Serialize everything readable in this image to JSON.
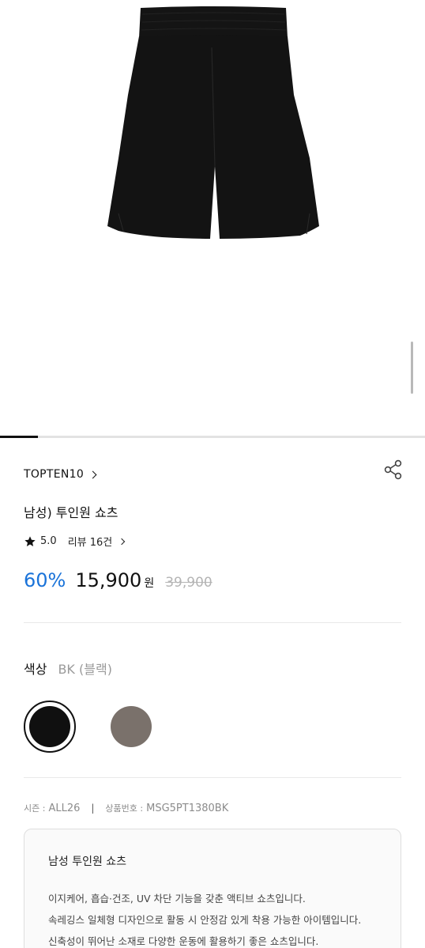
{
  "product": {
    "brand": "TOPTEN10",
    "title": "남성) 투인원 쇼츠",
    "rating": "5.0",
    "reviews_label": "리뷰 16건"
  },
  "price": {
    "discount": "60%",
    "sale": "15,900",
    "currency": "원",
    "original": "39,900"
  },
  "color": {
    "label": "색상",
    "selected": "BK (블랙)",
    "swatches": [
      {
        "name": "black",
        "hex": "#101010"
      },
      {
        "name": "brown-gray",
        "hex": "#7a716b"
      }
    ]
  },
  "meta": {
    "season_label": "시즌 :",
    "season_value": "ALL26",
    "code_label": "상품번호 :",
    "code_value": "MSG5PT1380BK"
  },
  "description": {
    "title": "남성 투인원 쇼츠",
    "lines": [
      "이지케어, 흡습·건조, UV 차단 기능을 갖춘 액티브 쇼츠입니다.",
      "속레깅스 일체형 디자인으로 활동 시 안정감 있게 착용 가능한 아이템입니다.",
      "신축성이 뛰어난 소재로 다양한 운동에 활용하기 좋은 쇼츠입니다."
    ]
  },
  "gallery": {
    "progress": 0.09
  },
  "colors": {
    "accent_blue": "#1a73d9",
    "product_black": "#101010"
  }
}
